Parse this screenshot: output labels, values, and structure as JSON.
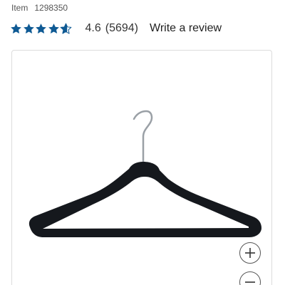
{
  "product": {
    "item_label": "Item",
    "item_number": "1298350",
    "rating": {
      "value": "4.6",
      "stars_out_of_5": 4.6,
      "review_count": "(5694)",
      "write_review_label": "Write a review",
      "star_color": "#0f5a94"
    },
    "image": {
      "subject": "black velvet clothes hanger with silver hook",
      "zoom_in_icon": "plus-icon",
      "zoom_out_icon": "minus-icon"
    }
  }
}
